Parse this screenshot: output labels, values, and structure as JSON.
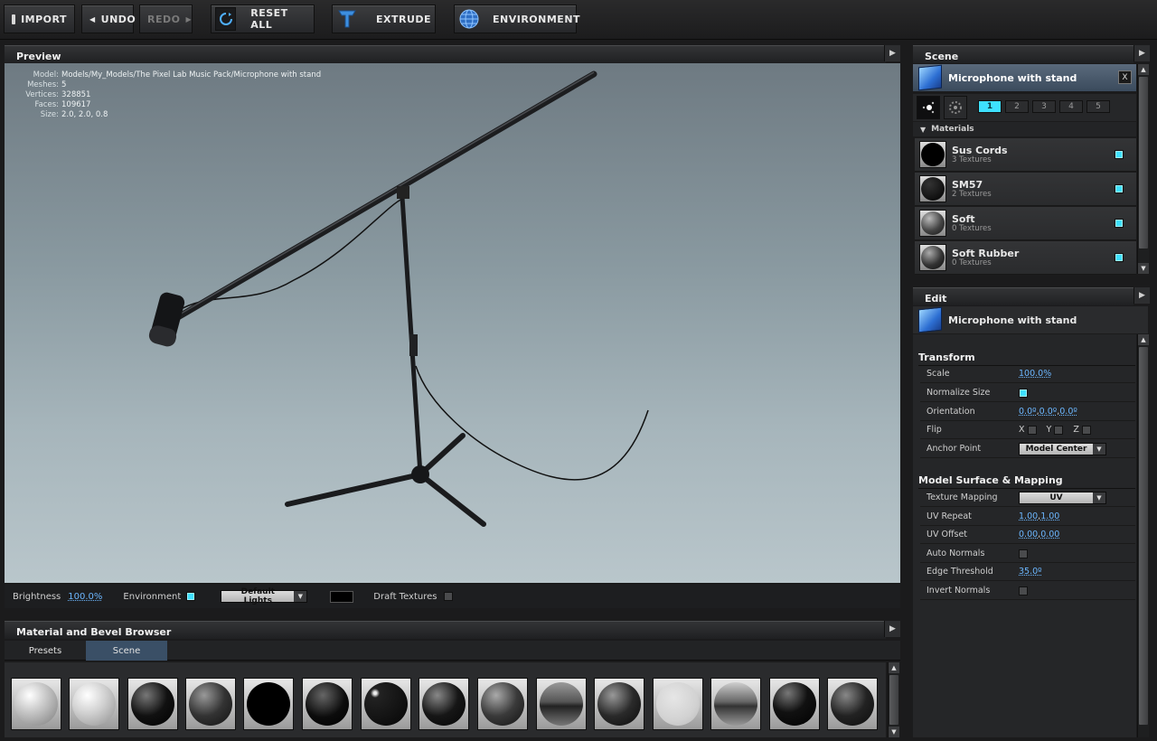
{
  "toolbar": {
    "import": "IMPORT",
    "undo": "UNDO",
    "redo": "REDO",
    "reset_all": "RESET ALL",
    "extrude": "EXTRUDE",
    "environment": "ENVIRONMENT"
  },
  "preview": {
    "title": "Preview",
    "info": {
      "model_label": "Model:",
      "model_value": "Models/My_Models/The Pixel Lab Music Pack/Microphone with stand",
      "meshes_label": "Meshes:",
      "meshes_value": "5",
      "vertices_label": "Vertices:",
      "vertices_value": "328851",
      "faces_label": "Faces:",
      "faces_value": "109617",
      "size_label": "Size:",
      "size_value": "2.0, 2.0, 0.8"
    },
    "bar": {
      "brightness_label": "Brightness",
      "brightness_value": "100.0%",
      "environment_label": "Environment",
      "lights_value": "Default Lights",
      "draft_label": "Draft Textures"
    }
  },
  "browser": {
    "title": "Material and Bevel Browser",
    "tabs": [
      "Presets",
      "Scene"
    ],
    "active_tab": "Scene"
  },
  "scene": {
    "title": "Scene",
    "object_name": "Microphone with stand",
    "close": "X",
    "light_tabs": [
      "1",
      "2",
      "3",
      "4",
      "5"
    ],
    "materials_label": "Materials",
    "materials": [
      {
        "name": "Sus Cords",
        "sub": "3 Textures"
      },
      {
        "name": "SM57",
        "sub": "2 Textures"
      },
      {
        "name": "Soft",
        "sub": "0 Textures"
      },
      {
        "name": "Soft Rubber",
        "sub": "0 Textures"
      }
    ]
  },
  "edit": {
    "title": "Edit",
    "object_name": "Microphone with stand",
    "transform_title": "Transform",
    "scale_label": "Scale",
    "scale_value": "100.0%",
    "normalize_label": "Normalize Size",
    "orientation_label": "Orientation",
    "orient_x": "0.0º",
    "orient_y": "0.0º",
    "orient_z": "0.0º",
    "flip_label": "Flip",
    "flip_x": "X",
    "flip_y": "Y",
    "flip_z": "Z",
    "anchor_label": "Anchor Point",
    "anchor_value": "Model Center",
    "surface_title": "Model Surface & Mapping",
    "texmap_label": "Texture Mapping",
    "texmap_value": "UV",
    "uvrepeat_label": "UV Repeat",
    "uvrepeat_a": "1.00",
    "uvrepeat_b": "1.00",
    "uvoffset_label": "UV Offset",
    "uvoffset_a": "0.00",
    "uvoffset_b": "0.00",
    "autonormals_label": "Auto Normals",
    "edge_label": "Edge Threshold",
    "edge_value": "35.0º",
    "invert_label": "Invert Normals"
  },
  "colors": {
    "accent": "#3ee0ff",
    "link": "#6cb7ff",
    "active_tab": "#3a4f66"
  }
}
